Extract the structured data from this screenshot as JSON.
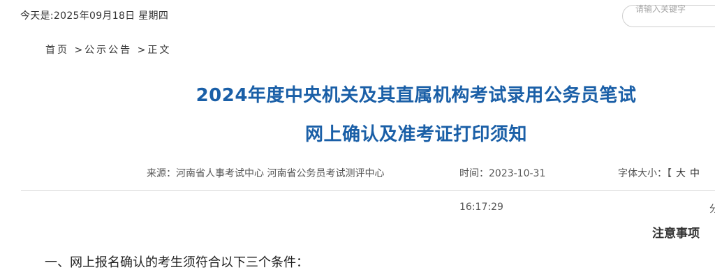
{
  "header": {
    "date_text": "今天是:2025年09月18日 星期四",
    "search_placeholder": "请输入关键字"
  },
  "breadcrumb": {
    "items": [
      {
        "label": "首页"
      },
      {
        "label": ">公示公告"
      },
      {
        "label": ">正文"
      }
    ]
  },
  "article": {
    "title_line1": "2024年度中央机关及其直属机构考试录用公务员笔试",
    "title_line2": "网上确认及准考证打印须知",
    "source": "来源：河南省人事考试中心 河南省公务员考试测评中心",
    "time_label": "时间：2023-10-31",
    "time_cont": "16:17:29",
    "fontsize_label": "字体大小：【",
    "fontsize_large": "大",
    "fontsize_medium": "中",
    "edge_char": "分",
    "notice_heading": "注意事项",
    "section1_heading": "一、网上报名确认的考生须符合以下三个条件："
  },
  "colors": {
    "title": "#1a5fa7",
    "text": "#333333",
    "meta": "#555555",
    "divider": "#d9d9d9"
  }
}
